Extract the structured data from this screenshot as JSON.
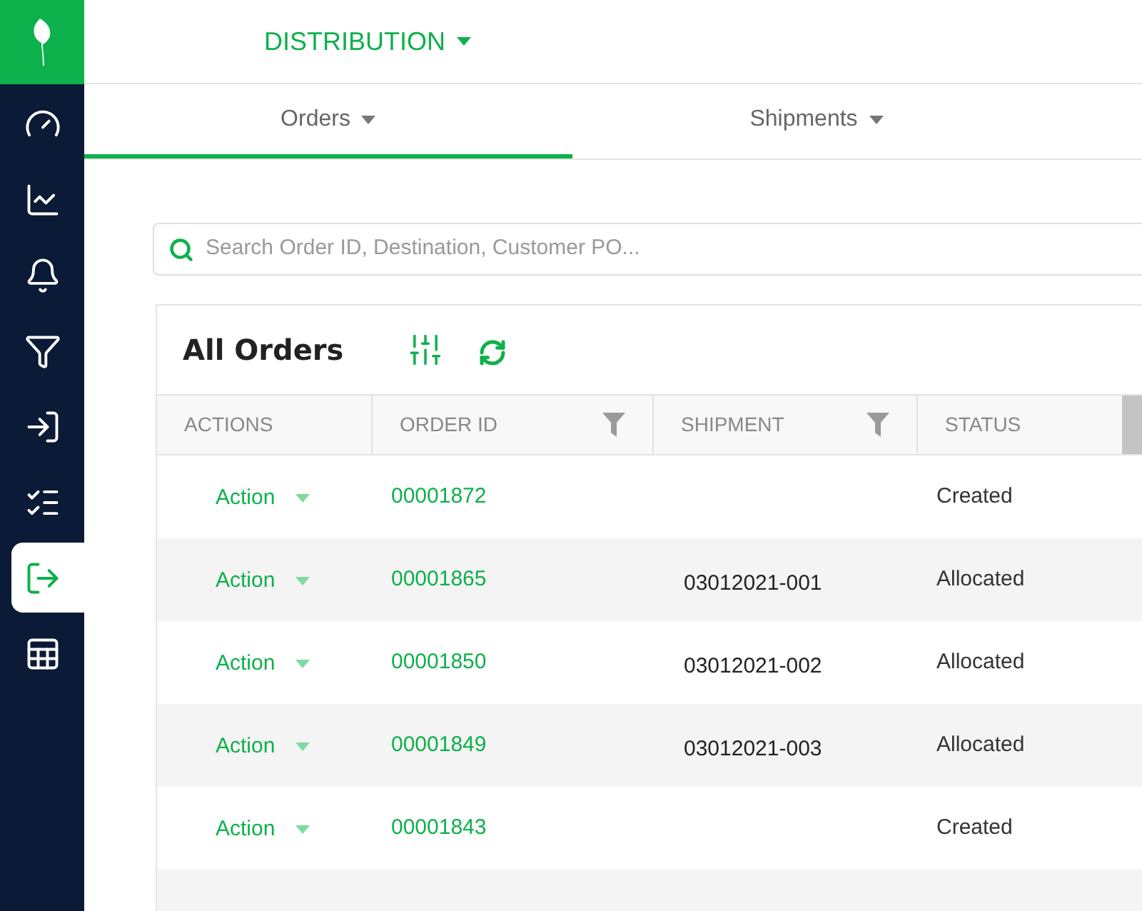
{
  "sidebar": {
    "items": [
      {
        "selected": false
      },
      {
        "selected": false
      },
      {
        "selected": false
      },
      {
        "selected": false
      },
      {
        "selected": false
      },
      {
        "selected": false
      },
      {
        "selected": true
      },
      {
        "selected": false
      }
    ]
  },
  "header": {
    "title": "DISTRIBUTION"
  },
  "tabs": [
    {
      "label": "Orders",
      "selected": true
    },
    {
      "label": "Shipments",
      "selected": false
    }
  ],
  "search": {
    "placeholder": "Search Order ID, Destination, Customer PO..."
  },
  "card": {
    "title": "All Orders"
  },
  "table": {
    "columns": [
      {
        "label": "ACTIONS",
        "filter": false
      },
      {
        "label": "ORDER ID",
        "filter": true
      },
      {
        "label": "SHIPMENT",
        "filter": true
      },
      {
        "label": "STATUS",
        "filter": false
      }
    ],
    "rows": [
      {
        "action": "Action",
        "order_id": "00001872",
        "shipment": "",
        "status": "Created"
      },
      {
        "action": "Action",
        "order_id": "00001865",
        "shipment": "03012021-001",
        "status": "Allocated"
      },
      {
        "action": "Action",
        "order_id": "00001850",
        "shipment": "03012021-002",
        "status": "Allocated"
      },
      {
        "action": "Action",
        "order_id": "00001849",
        "shipment": "03012021-003",
        "status": "Allocated"
      },
      {
        "action": "Action",
        "order_id": "00001843",
        "shipment": "",
        "status": "Created"
      }
    ]
  }
}
